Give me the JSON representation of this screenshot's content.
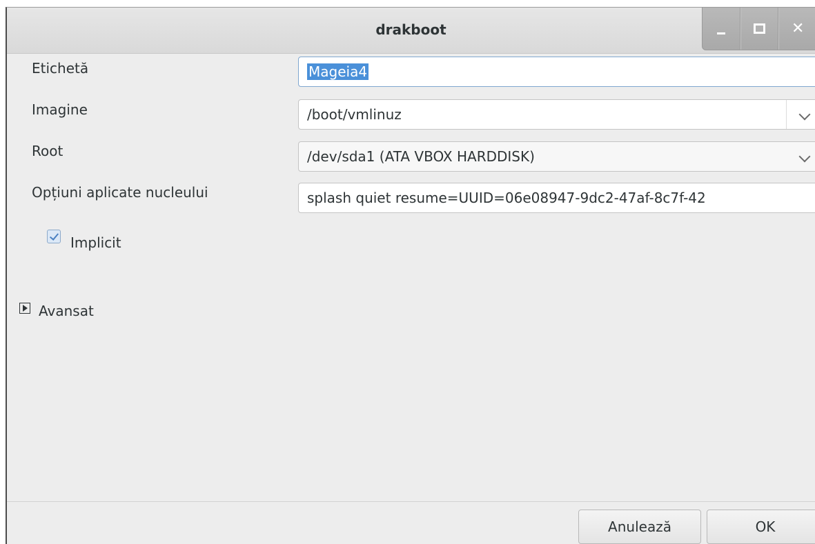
{
  "window": {
    "title": "drakboot",
    "controls": {
      "minimize_icon": "minimize-icon",
      "maximize_icon": "maximize-icon",
      "close_icon": "close-icon"
    }
  },
  "form": {
    "label_field": {
      "label": "Etichetă",
      "value": "Mageia4"
    },
    "image_field": {
      "label": "Imagine",
      "value": "/boot/vmlinuz"
    },
    "root_field": {
      "label": "Root",
      "value": "/dev/sda1 (ATA VBOX HARDDISK)"
    },
    "kernel_options": {
      "label": "Opțiuni aplicate nucleului",
      "value": "splash quiet resume=UUID=06e08947-9dc2-47af-8c7f-42"
    },
    "default_checkbox": {
      "label": "Implicit",
      "checked": true
    },
    "advanced_expander": {
      "label": "Avansat",
      "expanded": false
    }
  },
  "buttons": {
    "cancel": "Anulează",
    "ok": "OK"
  },
  "colors": {
    "selection": "#4a90d9",
    "window_bg": "#ededed"
  }
}
